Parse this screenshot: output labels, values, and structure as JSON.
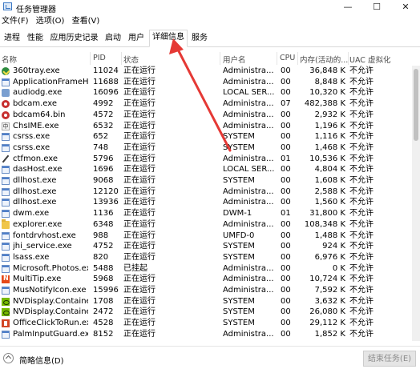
{
  "window": {
    "title": "任务管理器",
    "minimize_label": "—",
    "maximize_label": "☐",
    "close_label": "✕"
  },
  "menu": [
    "文件(F)",
    "选项(O)",
    "查看(V)"
  ],
  "tabs": [
    "进程",
    "性能",
    "应用历史记录",
    "启动",
    "用户",
    "详细信息",
    "服务"
  ],
  "active_tab": "详细信息",
  "columns": {
    "name": "名称",
    "pid": "PID",
    "status": "状态",
    "user": "用户名",
    "cpu": "CPU",
    "memory": "内存(活动的...",
    "uac": "UAC 虚拟化"
  },
  "processes": [
    {
      "name": "360tray.exe",
      "icon": "green-check-icon",
      "pid": "11024",
      "status": "正在运行",
      "user": "Administra...",
      "cpu": "00",
      "memory": "36,848 K",
      "uac": "不允许"
    },
    {
      "name": "ApplicationFrameH...",
      "icon": "app-window-icon",
      "pid": "11688",
      "status": "正在运行",
      "user": "Administra...",
      "cpu": "00",
      "memory": "8,848 K",
      "uac": "不允许"
    },
    {
      "name": "audiodg.exe",
      "icon": "speaker-icon",
      "pid": "16096",
      "status": "正在运行",
      "user": "LOCAL SER...",
      "cpu": "00",
      "memory": "10,320 K",
      "uac": "不允许"
    },
    {
      "name": "bdcam.exe",
      "icon": "record-icon",
      "pid": "4992",
      "status": "正在运行",
      "user": "Administra...",
      "cpu": "07",
      "memory": "482,388 K",
      "uac": "不允许"
    },
    {
      "name": "bdcam64.bin",
      "icon": "record-icon",
      "pid": "4572",
      "status": "正在运行",
      "user": "Administra...",
      "cpu": "00",
      "memory": "2,932 K",
      "uac": "不允许"
    },
    {
      "name": "ChsIME.exe",
      "icon": "ime-icon",
      "pid": "6532",
      "status": "正在运行",
      "user": "Administra...",
      "cpu": "00",
      "memory": "1,196 K",
      "uac": "不允许"
    },
    {
      "name": "csrss.exe",
      "icon": "app-window-icon",
      "pid": "652",
      "status": "正在运行",
      "user": "SYSTEM",
      "cpu": "00",
      "memory": "1,116 K",
      "uac": "不允许"
    },
    {
      "name": "csrss.exe",
      "icon": "app-window-icon",
      "pid": "748",
      "status": "正在运行",
      "user": "SYSTEM",
      "cpu": "00",
      "memory": "1,468 K",
      "uac": "不允许"
    },
    {
      "name": "ctfmon.exe",
      "icon": "pen-icon",
      "pid": "5796",
      "status": "正在运行",
      "user": "Administra...",
      "cpu": "01",
      "memory": "10,536 K",
      "uac": "不允许"
    },
    {
      "name": "dasHost.exe",
      "icon": "app-window-icon",
      "pid": "1696",
      "status": "正在运行",
      "user": "LOCAL SER...",
      "cpu": "00",
      "memory": "4,804 K",
      "uac": "不允许"
    },
    {
      "name": "dllhost.exe",
      "icon": "app-window-icon",
      "pid": "9068",
      "status": "正在运行",
      "user": "SYSTEM",
      "cpu": "00",
      "memory": "1,608 K",
      "uac": "不允许"
    },
    {
      "name": "dllhost.exe",
      "icon": "app-window-icon",
      "pid": "12120",
      "status": "正在运行",
      "user": "Administra...",
      "cpu": "00",
      "memory": "2,588 K",
      "uac": "不允许"
    },
    {
      "name": "dllhost.exe",
      "icon": "app-window-icon",
      "pid": "13936",
      "status": "正在运行",
      "user": "Administra...",
      "cpu": "00",
      "memory": "1,560 K",
      "uac": "不允许"
    },
    {
      "name": "dwm.exe",
      "icon": "app-window-icon",
      "pid": "1136",
      "status": "正在运行",
      "user": "DWM-1",
      "cpu": "01",
      "memory": "31,800 K",
      "uac": "不允许"
    },
    {
      "name": "explorer.exe",
      "icon": "folder-icon",
      "pid": "6348",
      "status": "正在运行",
      "user": "Administra...",
      "cpu": "00",
      "memory": "108,348 K",
      "uac": "不允许"
    },
    {
      "name": "fontdrvhost.exe",
      "icon": "app-window-icon",
      "pid": "988",
      "status": "正在运行",
      "user": "UMFD-0",
      "cpu": "00",
      "memory": "1,488 K",
      "uac": "不允许"
    },
    {
      "name": "jhi_service.exe",
      "icon": "app-window-icon",
      "pid": "4752",
      "status": "正在运行",
      "user": "SYSTEM",
      "cpu": "00",
      "memory": "924 K",
      "uac": "不允许"
    },
    {
      "name": "lsass.exe",
      "icon": "app-window-icon",
      "pid": "820",
      "status": "正在运行",
      "user": "SYSTEM",
      "cpu": "00",
      "memory": "6,976 K",
      "uac": "不允许"
    },
    {
      "name": "Microsoft.Photos.exe",
      "icon": "app-window-icon",
      "pid": "5488",
      "status": "已挂起",
      "user": "Administra...",
      "cpu": "00",
      "memory": "0 K",
      "uac": "不允许"
    },
    {
      "name": "MultiTip.exe",
      "icon": "multitip-icon",
      "pid": "5968",
      "status": "正在运行",
      "user": "Administra...",
      "cpu": "00",
      "memory": "10,724 K",
      "uac": "不允许"
    },
    {
      "name": "MusNotifyIcon.exe",
      "icon": "app-window-icon",
      "pid": "15996",
      "status": "正在运行",
      "user": "Administra...",
      "cpu": "00",
      "memory": "7,592 K",
      "uac": "不允许"
    },
    {
      "name": "NVDisplay.Containe...",
      "icon": "nvidia-icon",
      "pid": "1708",
      "status": "正在运行",
      "user": "SYSTEM",
      "cpu": "00",
      "memory": "3,632 K",
      "uac": "不允许"
    },
    {
      "name": "NVDisplay.Containe...",
      "icon": "nvidia-icon",
      "pid": "2472",
      "status": "正在运行",
      "user": "SYSTEM",
      "cpu": "00",
      "memory": "26,080 K",
      "uac": "不允许"
    },
    {
      "name": "OfficeClickToRun.exe",
      "icon": "office-icon",
      "pid": "4528",
      "status": "正在运行",
      "user": "SYSTEM",
      "cpu": "00",
      "memory": "29,112 K",
      "uac": "不允许"
    },
    {
      "name": "PalmInputGuard.exe",
      "icon": "app-window-icon",
      "pid": "8152",
      "status": "正在运行",
      "user": "Administra...",
      "cpu": "00",
      "memory": "1,852 K",
      "uac": "不允许"
    }
  ],
  "footer": {
    "toggle_label": "简略信息(D)",
    "end_task_label": "结束任务(E)"
  },
  "colors": {
    "annotation_arrow": "#e53935",
    "tab_border": "#d9d9d9",
    "disabled_button": "#e5e5e5"
  }
}
